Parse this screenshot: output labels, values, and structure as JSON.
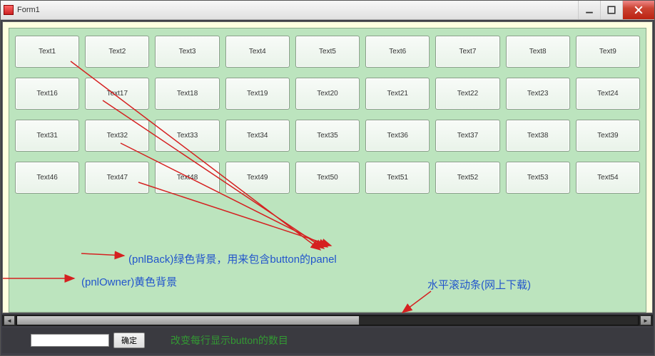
{
  "window": {
    "title": "Form1"
  },
  "grid": {
    "rows": [
      [
        "Text1",
        "Text2",
        "Text3",
        "Text4",
        "Text5",
        "Text6",
        "Text7",
        "Text8",
        "Text9"
      ],
      [
        "Text16",
        "Text17",
        "Text18",
        "Text19",
        "Text20",
        "Text21",
        "Text22",
        "Text23",
        "Text24"
      ],
      [
        "Text31",
        "Text32",
        "Text33",
        "Text34",
        "Text35",
        "Text36",
        "Text37",
        "Text38",
        "Text39"
      ],
      [
        "Text46",
        "Text47",
        "Text48",
        "Text49",
        "Text50",
        "Text51",
        "Text52",
        "Text53",
        "Text54"
      ]
    ]
  },
  "bottom": {
    "input_value": "",
    "submit_label": "确定"
  },
  "annotations": {
    "a1": "(pnlBack)绿色背景，用来包含button的panel",
    "a2": "(pnlOwner)黄色背景",
    "a3": "水平滚动条(网上下载)",
    "a4": "改变每行显示button的数目"
  }
}
